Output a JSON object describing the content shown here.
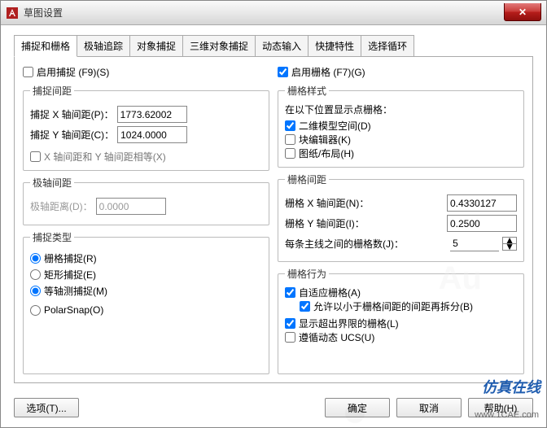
{
  "window": {
    "title": "草图设置"
  },
  "tabs": [
    {
      "label": "捕捉和栅格"
    },
    {
      "label": "极轴追踪"
    },
    {
      "label": "对象捕捉"
    },
    {
      "label": "三维对象捕捉"
    },
    {
      "label": "动态输入"
    },
    {
      "label": "快捷特性"
    },
    {
      "label": "选择循环"
    }
  ],
  "left": {
    "enableSnap": "启用捕捉  (F9)(S)",
    "snapSpacing": {
      "legend": "捕捉间距",
      "xLabel": "捕捉 X 轴间距(P)：",
      "xValue": "1773.62002",
      "yLabel": "捕捉 Y 轴间距(C)：",
      "yValue": "1024.0000",
      "equalLabel": "X 轴间距和 Y 轴间距相等(X)"
    },
    "polarSpacing": {
      "legend": "极轴间距",
      "distLabel": "极轴距离(D)：",
      "distValue": "0.0000"
    },
    "snapType": {
      "legend": "捕捉类型",
      "gridSnap": "栅格捕捉(R)",
      "rectSnap": "矩形捕捉(E)",
      "isoSnap": "等轴测捕捉(M)",
      "polarSnap": "PolarSnap(O)"
    }
  },
  "right": {
    "enableGrid": "启用栅格  (F7)(G)",
    "gridStyle": {
      "legend": "栅格样式",
      "caption": "在以下位置显示点栅格：",
      "twoD": "二维模型空间(D)",
      "blockEditor": "块编辑器(K)",
      "paperLayout": "图纸/布局(H)"
    },
    "gridSpacing": {
      "legend": "栅格间距",
      "xLabel": "栅格 X 轴间距(N)：",
      "xValue": "0.4330127",
      "yLabel": "栅格 Y 轴间距(I)：",
      "yValue": "0.2500",
      "majorLabel": "每条主线之间的栅格数(J)：",
      "majorValue": "5"
    },
    "gridBehavior": {
      "legend": "栅格行为",
      "adaptive": "自适应栅格(A)",
      "subdivide": "允许以小于栅格间距的间距再拆分(B)",
      "beyondLimits": "显示超出界限的栅格(L)",
      "followUCS": "遵循动态 UCS(U)"
    }
  },
  "buttons": {
    "options": "选项(T)...",
    "ok": "确定",
    "cancel": "取消",
    "help": "帮助(H)"
  },
  "watermarks": {
    "brand": "仿真在线",
    "url": "www.1CAE.com",
    "faint": "Au"
  }
}
